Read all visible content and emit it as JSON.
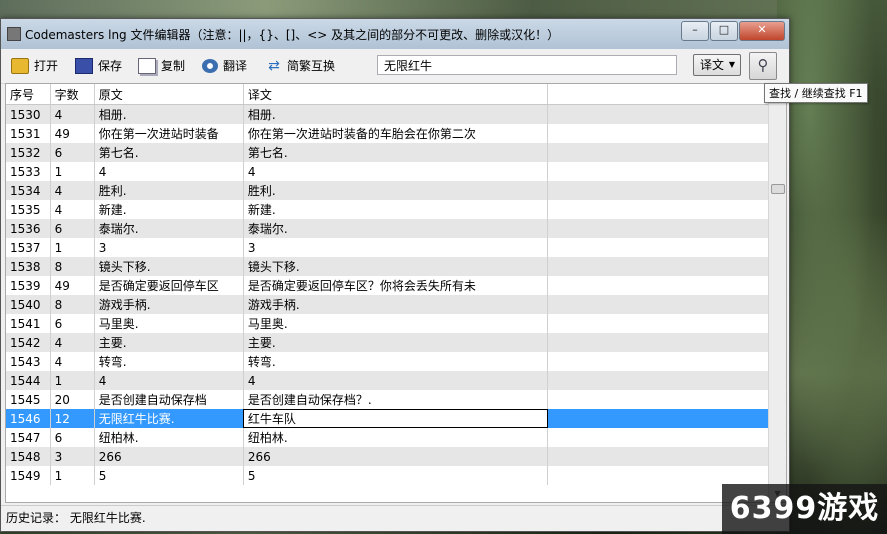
{
  "window": {
    "title": "Codemasters lng 文件编辑器（注意：||，{}、[]、<> 及其之间的部分不可更改、删除或汉化！）"
  },
  "toolbar": {
    "open_label": "打开",
    "save_label": "保存",
    "copy_label": "复制",
    "translate_label": "翻译",
    "swap_label": "简繁互换",
    "search_value": "无限红牛",
    "search_target": "译文",
    "search_tooltip": "查找 / 继续查找 F1"
  },
  "table": {
    "headers": [
      "序号",
      "字数",
      "原文",
      "译文"
    ],
    "rows": [
      {
        "seq": "1530",
        "count": "4",
        "src": "相册.",
        "tr": "相册."
      },
      {
        "seq": "1531",
        "count": "49",
        "src": "你在第一次进站时装备",
        "tr": "你在第一次进站时装备的车胎会在你第二次"
      },
      {
        "seq": "1532",
        "count": "6",
        "src": "第七名.",
        "tr": "第七名."
      },
      {
        "seq": "1533",
        "count": "1",
        "src": "4",
        "tr": "4"
      },
      {
        "seq": "1534",
        "count": "4",
        "src": "胜利.",
        "tr": "胜利."
      },
      {
        "seq": "1535",
        "count": "4",
        "src": "新建.",
        "tr": "新建."
      },
      {
        "seq": "1536",
        "count": "6",
        "src": "泰瑞尔.",
        "tr": "泰瑞尔."
      },
      {
        "seq": "1537",
        "count": "1",
        "src": "3",
        "tr": "3"
      },
      {
        "seq": "1538",
        "count": "8",
        "src": "镜头下移.",
        "tr": "镜头下移."
      },
      {
        "seq": "1539",
        "count": "49",
        "src": "是否确定要返回停车区",
        "tr": "是否确定要返回停车区？你将会丢失所有未"
      },
      {
        "seq": "1540",
        "count": "8",
        "src": "游戏手柄.",
        "tr": "游戏手柄."
      },
      {
        "seq": "1541",
        "count": "6",
        "src": "马里奥.",
        "tr": "马里奥."
      },
      {
        "seq": "1542",
        "count": "4",
        "src": "主要.",
        "tr": "主要."
      },
      {
        "seq": "1543",
        "count": "4",
        "src": "转弯.",
        "tr": "转弯."
      },
      {
        "seq": "1544",
        "count": "1",
        "src": "4",
        "tr": "4"
      },
      {
        "seq": "1545",
        "count": "20",
        "src": "是否创建自动保存档",
        "tr": "是否创建自动保存档？."
      },
      {
        "seq": "1546",
        "count": "12",
        "src": "无限红牛比赛.",
        "tr": "红牛车队"
      },
      {
        "seq": "1547",
        "count": "6",
        "src": "纽柏林.",
        "tr": "纽柏林."
      },
      {
        "seq": "1548",
        "count": "3",
        "src": "266",
        "tr": "266"
      },
      {
        "seq": "1549",
        "count": "1",
        "src": "5",
        "tr": "5"
      }
    ],
    "selected_seq": "1546"
  },
  "status": {
    "history_label": "历史记录：",
    "history_value": "无限红牛比赛."
  },
  "watermark": "6399游戏"
}
